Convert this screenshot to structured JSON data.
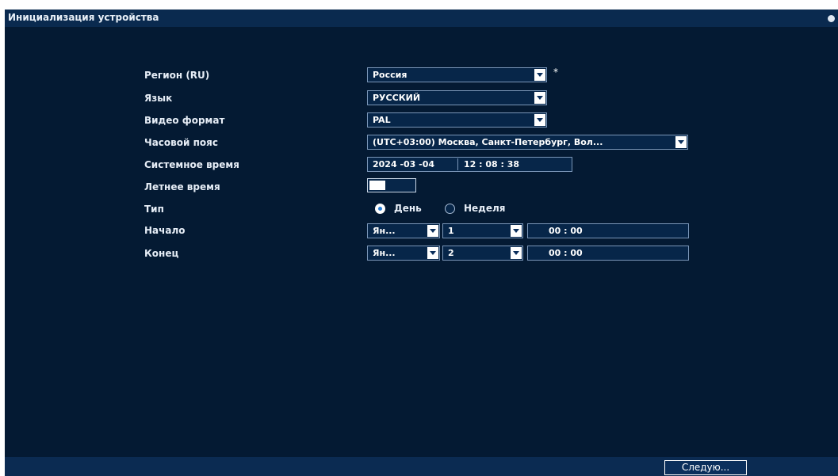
{
  "window": {
    "title": "Инициализация устройства"
  },
  "form": {
    "region": {
      "label": "Регион (RU)",
      "value": "Россия",
      "required_mark": "*"
    },
    "language": {
      "label": "Язык",
      "value": "РУССКИЙ"
    },
    "video_format": {
      "label": "Видео формат",
      "value": "PAL"
    },
    "timezone": {
      "label": "Часовой пояс",
      "value": "(UTC+03:00) Москва, Санкт-Петербург, Вол..."
    },
    "system_time": {
      "label": "Системное время",
      "date": "2024 -03 -04",
      "time": "12 : 08 : 38"
    },
    "dst": {
      "label": "Летнее время",
      "enabled": true
    },
    "type": {
      "label": "Тип",
      "options": [
        "День",
        "Неделя"
      ],
      "selected": "День"
    },
    "start": {
      "label": "Начало",
      "month": "Ян...",
      "day": "1",
      "time": "00  :  00"
    },
    "end": {
      "label": "Конец",
      "month": "Ян...",
      "day": "2",
      "time": "00  :  00"
    }
  },
  "footer": {
    "next_label": "Следую..."
  }
}
